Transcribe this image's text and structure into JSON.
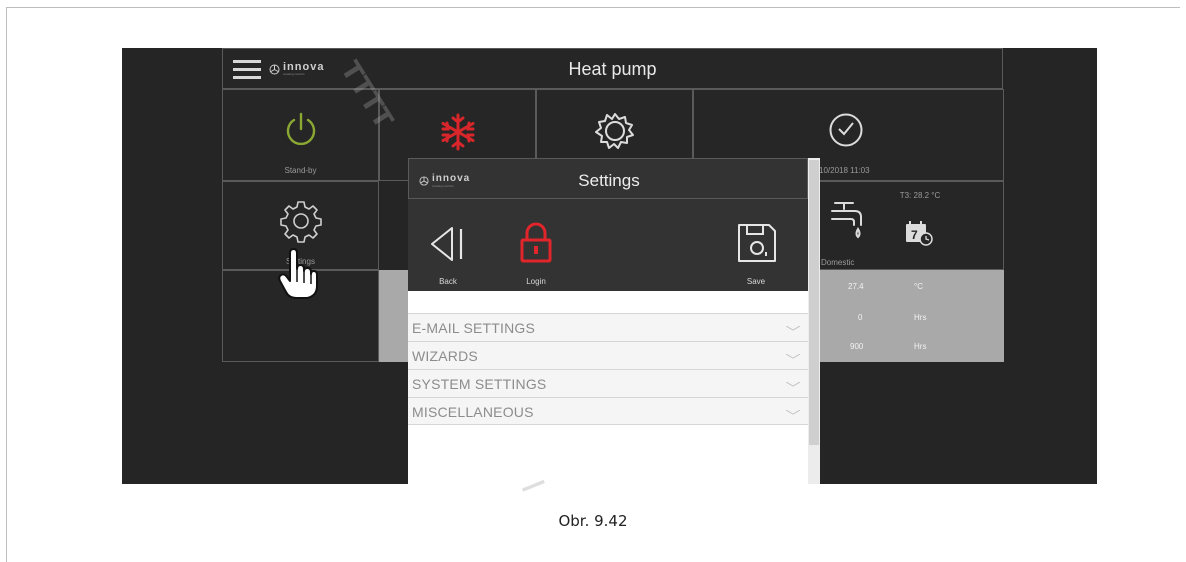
{
  "app": {
    "header_title": "Heat pump",
    "logo_text": "innova",
    "logo_subtext": "creating comfort",
    "accent_power": "#8aa832",
    "accent_cold": "#d9262b",
    "accent_lock": "#e0262b"
  },
  "tiles": {
    "standby_label": "Stand-by",
    "settings_label": "Settings",
    "datetime": "10/2018 11:03",
    "t3_reading": "T3: 28.2 °C",
    "domestic_label": "Domestic",
    "calendar_day": "7"
  },
  "data_rows": [
    {
      "value": "27.4",
      "unit": "°C"
    },
    {
      "value": "0",
      "unit": "Hrs"
    },
    {
      "value": "900",
      "unit": "Hrs"
    }
  ],
  "modal": {
    "title": "Settings",
    "back_label": "Back",
    "login_label": "Login",
    "save_label": "Save",
    "items": [
      {
        "label": "E-MAIL SETTINGS"
      },
      {
        "label": "WIZARDS"
      },
      {
        "label": "SYSTEM SETTINGS"
      },
      {
        "label": "MISCELLANEOUS"
      }
    ]
  },
  "caption": "Obr. 9.42"
}
